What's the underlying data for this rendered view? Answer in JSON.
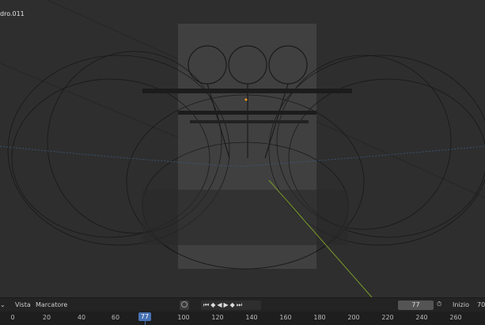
{
  "viewport": {
    "object_name": "dro.011"
  },
  "timeline": {
    "menu": [
      "Vista",
      "Marcatore"
    ],
    "current_frame": "77",
    "start_label": "Inizio",
    "start_value": "70",
    "ruler_ticks": [
      "0",
      "20",
      "40",
      "60",
      "100",
      "120",
      "140",
      "160",
      "180",
      "200",
      "220",
      "240",
      "260"
    ],
    "playhead": "77",
    "accent": "#4772b3"
  }
}
